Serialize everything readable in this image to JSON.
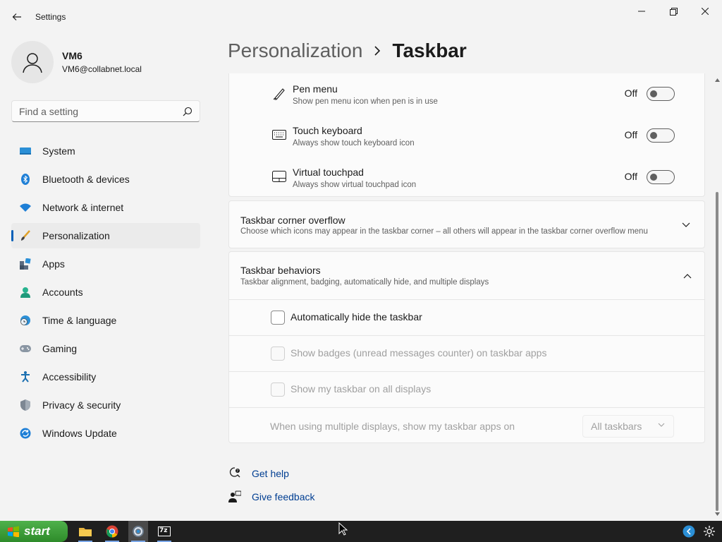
{
  "window": {
    "title": "Settings"
  },
  "profile": {
    "name": "VM6",
    "email": "VM6@collabnet.local"
  },
  "search": {
    "placeholder": "Find a setting"
  },
  "sidebar": {
    "items": [
      {
        "label": "System",
        "icon": "system-icon"
      },
      {
        "label": "Bluetooth & devices",
        "icon": "bluetooth-icon"
      },
      {
        "label": "Network & internet",
        "icon": "wifi-icon"
      },
      {
        "label": "Personalization",
        "icon": "brush-icon",
        "selected": true
      },
      {
        "label": "Apps",
        "icon": "apps-icon"
      },
      {
        "label": "Accounts",
        "icon": "accounts-icon"
      },
      {
        "label": "Time & language",
        "icon": "clock-globe-icon"
      },
      {
        "label": "Gaming",
        "icon": "gamepad-icon"
      },
      {
        "label": "Accessibility",
        "icon": "accessibility-icon"
      },
      {
        "label": "Privacy & security",
        "icon": "shield-icon"
      },
      {
        "label": "Windows Update",
        "icon": "update-icon"
      }
    ]
  },
  "breadcrumb": {
    "parent": "Personalization",
    "current": "Taskbar"
  },
  "system_tray_icons": [
    {
      "title": "Pen menu",
      "desc": "Show pen menu icon when pen is in use",
      "state": "Off",
      "icon": "pen-icon"
    },
    {
      "title": "Touch keyboard",
      "desc": "Always show touch keyboard icon",
      "state": "Off",
      "icon": "keyboard-icon"
    },
    {
      "title": "Virtual touchpad",
      "desc": "Always show virtual touchpad icon",
      "state": "Off",
      "icon": "touchpad-icon"
    }
  ],
  "corner_overflow": {
    "title": "Taskbar corner overflow",
    "desc": "Choose which icons may appear in the taskbar corner – all others will appear in the taskbar corner overflow menu"
  },
  "behaviors": {
    "title": "Taskbar behaviors",
    "desc": "Taskbar alignment, badging, automatically hide, and multiple displays",
    "options": [
      {
        "label": "Automatically hide the taskbar",
        "checked": false,
        "enabled": true
      },
      {
        "label": "Show badges (unread messages counter) on taskbar apps",
        "checked": false,
        "enabled": false
      },
      {
        "label": "Show my taskbar on all displays",
        "checked": false,
        "enabled": false
      }
    ],
    "multi_display_label": "When using multiple displays, show my taskbar apps on",
    "multi_display_value": "All taskbars"
  },
  "links": {
    "help": "Get help",
    "feedback": "Give feedback"
  },
  "taskbar": {
    "start_label": "start",
    "apps": [
      "file-explorer-icon",
      "chrome-icon",
      "settings-app-icon",
      "7zip-icon"
    ],
    "zip_label": "7z"
  },
  "colors": {
    "accent": "#005fb8",
    "link": "#003e92",
    "start_green": "#3a9b36"
  }
}
